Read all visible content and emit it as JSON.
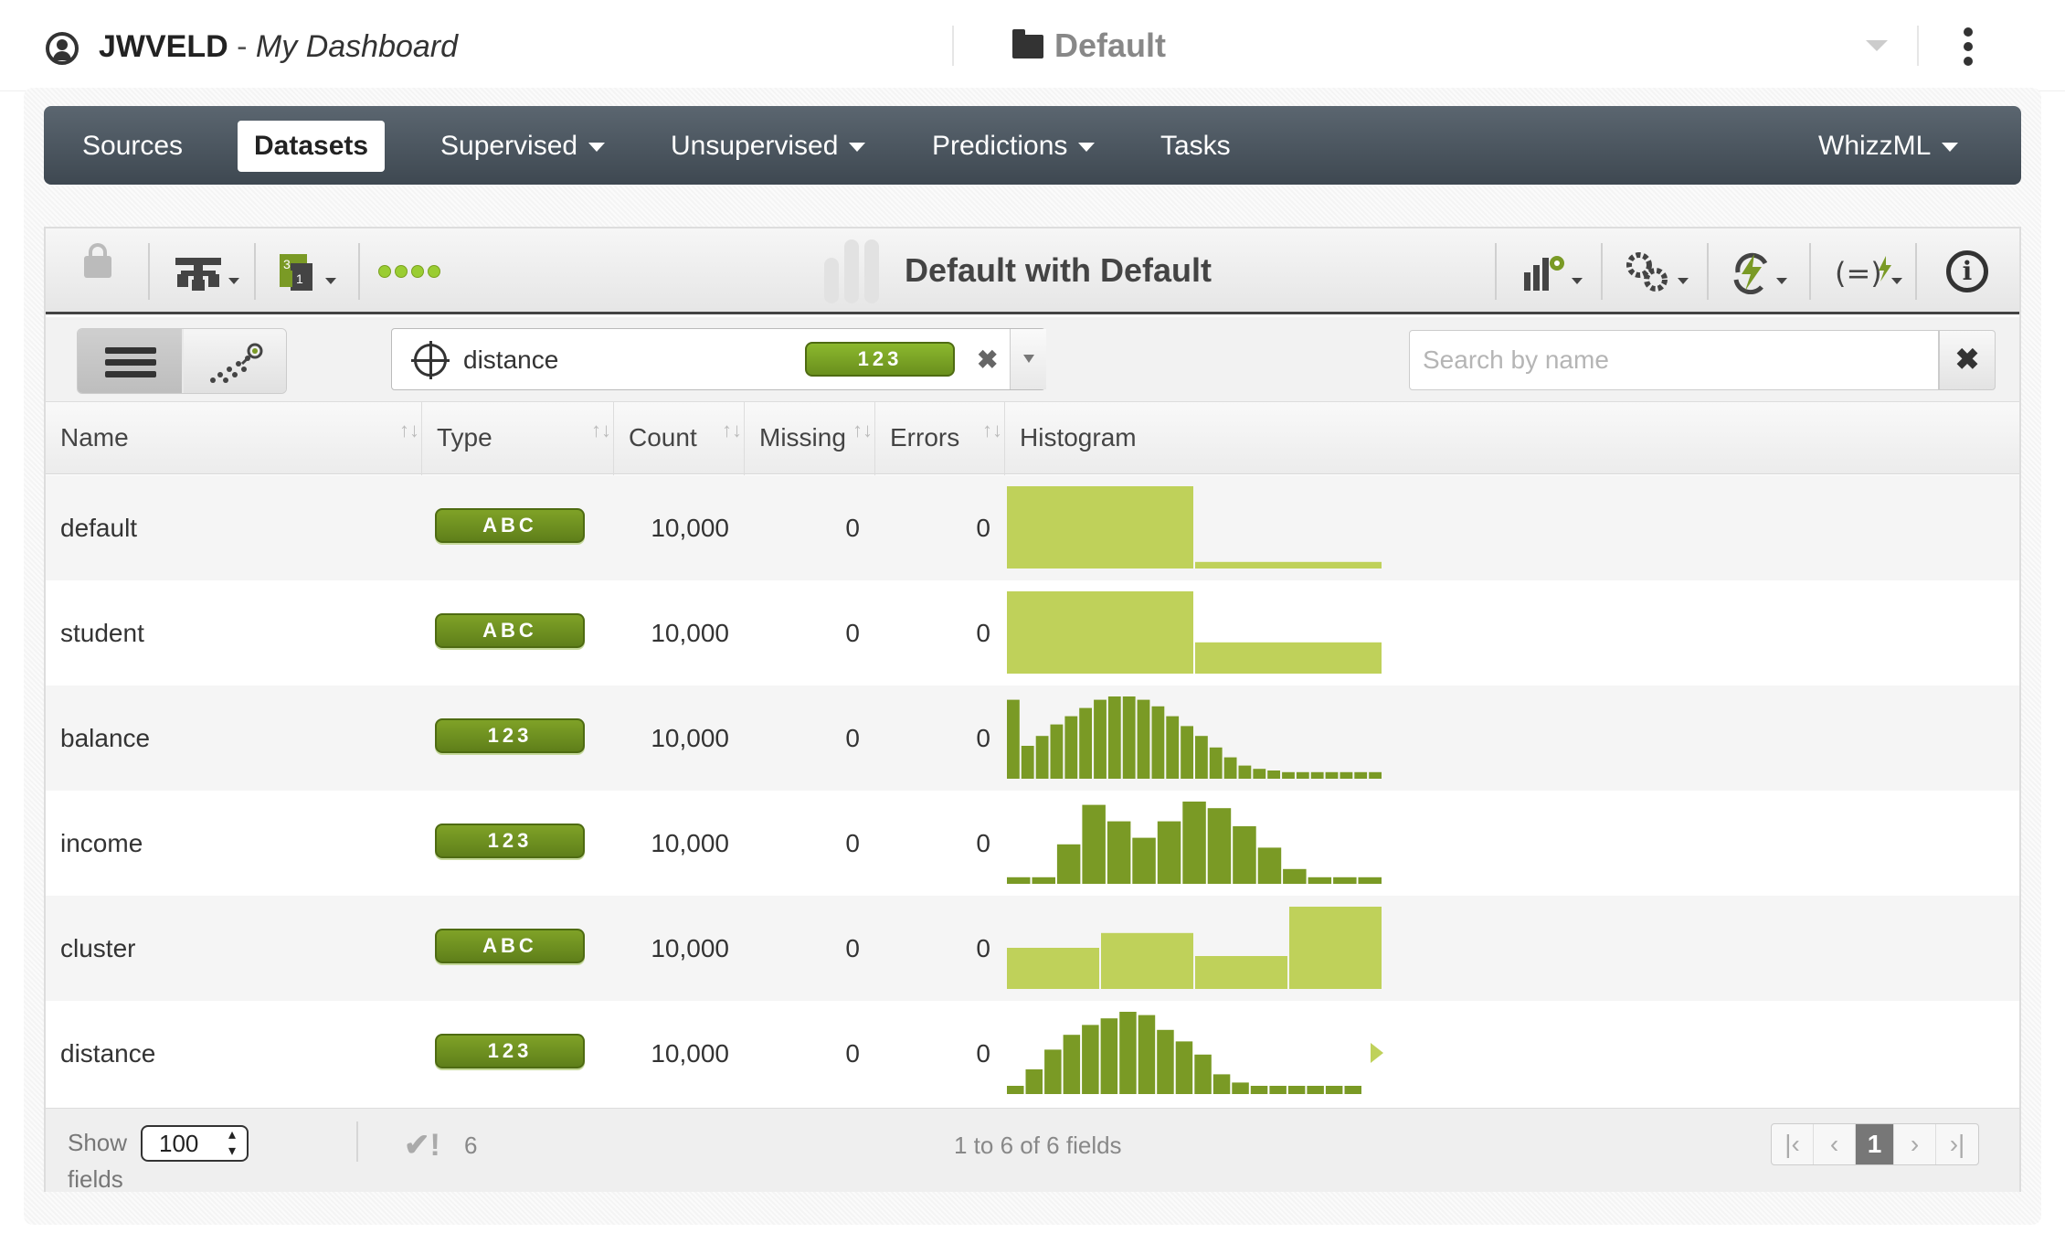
{
  "header": {
    "user": "JWVELD",
    "separator": "-",
    "dashboard": "My Dashboard",
    "project": "Default"
  },
  "nav": {
    "sources": "Sources",
    "datasets": "Datasets",
    "supervised": "Supervised",
    "unsupervised": "Unsupervised",
    "predictions": "Predictions",
    "tasks": "Tasks",
    "whizzml": "WhizzML"
  },
  "toolbar": {
    "dataset_title": "Default with Default",
    "icons": [
      "lock-icon",
      "model-tree-icon",
      "sample-icon",
      "status-dots-icon",
      "chart-config-icon",
      "gears-icon",
      "lightning-icon",
      "formula-icon",
      "info-icon"
    ]
  },
  "filter": {
    "objective_field": "distance",
    "objective_type": "123",
    "clear_symbol": "✖",
    "search_placeholder": "Search by name",
    "search_clear_symbol": "✖"
  },
  "table": {
    "columns": {
      "name": "Name",
      "type": "Type",
      "count": "Count",
      "missing": "Missing",
      "errors": "Errors",
      "histogram": "Histogram"
    },
    "rows": [
      {
        "name": "default",
        "type": "ABC",
        "count": "10,000",
        "missing": "0",
        "errors": "0",
        "histogram": {
          "kind": "categorical",
          "values": [
            100,
            8
          ]
        }
      },
      {
        "name": "student",
        "type": "ABC",
        "count": "10,000",
        "missing": "0",
        "errors": "0",
        "histogram": {
          "kind": "categorical",
          "values": [
            100,
            38
          ]
        }
      },
      {
        "name": "balance",
        "type": "123",
        "count": "10,000",
        "missing": "0",
        "errors": "0",
        "histogram": {
          "kind": "numeric",
          "values": [
            96,
            40,
            52,
            66,
            76,
            86,
            96,
            100,
            100,
            96,
            88,
            76,
            64,
            52,
            38,
            26,
            16,
            12,
            10,
            8,
            8,
            8,
            8,
            8,
            8,
            8
          ]
        }
      },
      {
        "name": "income",
        "type": "123",
        "count": "10,000",
        "missing": "0",
        "errors": "0",
        "histogram": {
          "kind": "numeric",
          "values": [
            8,
            8,
            48,
            96,
            76,
            56,
            76,
            100,
            92,
            70,
            44,
            18,
            8,
            8,
            8
          ]
        }
      },
      {
        "name": "cluster",
        "type": "ABC",
        "count": "10,000",
        "missing": "0",
        "errors": "0",
        "histogram": {
          "kind": "categorical",
          "values": [
            50,
            68,
            40,
            100
          ]
        }
      },
      {
        "name": "distance",
        "type": "123",
        "count": "10,000",
        "missing": "0",
        "errors": "0",
        "histogram": {
          "kind": "numeric",
          "values": [
            10,
            30,
            54,
            72,
            84,
            92,
            100,
            96,
            78,
            64,
            48,
            24,
            14,
            10,
            10,
            10,
            10,
            10,
            10
          ],
          "objective": true
        }
      }
    ]
  },
  "footer": {
    "show_label": "Show",
    "page_size": "100",
    "fields_label": "fields",
    "check_count": "6",
    "range_text": "1 to 6 of 6 fields",
    "current_page": "1"
  },
  "colors": {
    "nav_bg": "#4a545e",
    "accent_green": "#6a8f1d",
    "hist_light": "#bfd15a",
    "hist_dark": "#7a9a25"
  }
}
